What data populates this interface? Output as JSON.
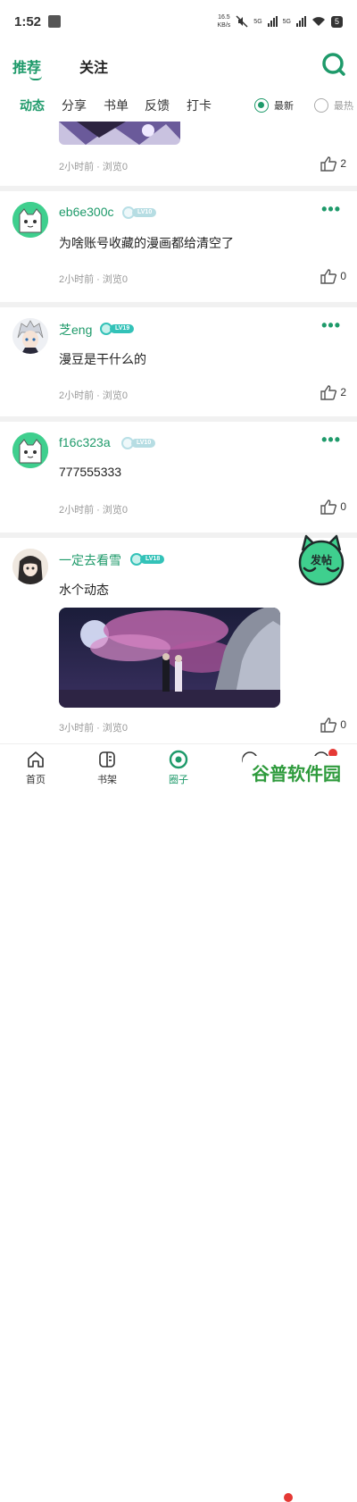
{
  "status": {
    "time": "1:52",
    "net_speed_top": "16.5",
    "net_speed_bottom": "KB/s",
    "sig1": "5G",
    "sig2": "5G",
    "battery": "5"
  },
  "top_tabs": {
    "recommend": "推荐",
    "follow": "关注"
  },
  "sub_tabs": [
    "动态",
    "分享",
    "书单",
    "反馈",
    "打卡"
  ],
  "sort": {
    "latest": "最新",
    "hottest": "最热"
  },
  "posts": [
    {
      "time": "2小时前 · 浏览0",
      "likes": "2"
    },
    {
      "name": "eb6e300c",
      "level": "LV10",
      "text": "为啥账号收藏的漫画都给清空了",
      "time": "2小时前 · 浏览0",
      "likes": "0"
    },
    {
      "name": "芝eng",
      "level": "LV19",
      "text": "漫豆是干什么的",
      "time": "2小时前 · 浏览0",
      "likes": "2"
    },
    {
      "name": "f16c323a",
      "level": "LV10",
      "text": "777555333",
      "time": "2小时前 · 浏览0",
      "likes": "0"
    },
    {
      "name": "一定去看雪",
      "level": "LV18",
      "text": "水个动态",
      "time": "3小时前 · 浏览0",
      "likes": "0"
    }
  ],
  "fab_label": "发帖",
  "bottom_nav": [
    "首页",
    "书架",
    "圈子",
    "",
    ""
  ],
  "watermark": "谷普软件园",
  "colors": {
    "accent": "#1e9a6a",
    "fab": "#3fcf8e"
  }
}
